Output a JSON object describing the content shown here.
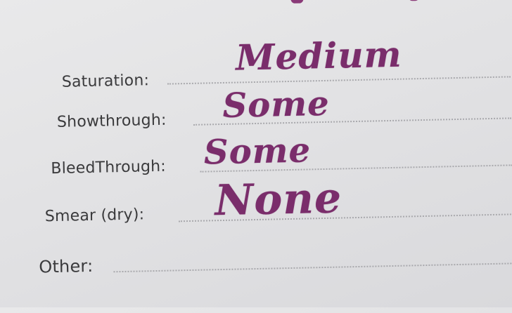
{
  "form": {
    "rows": [
      {
        "label": "Saturation:",
        "value": "Medium"
      },
      {
        "label": "Showthrough:",
        "value": "Some"
      },
      {
        "label": "BleedThrough:",
        "value": "Some"
      },
      {
        "label": "Smear (dry):",
        "value": "None"
      },
      {
        "label": "Other:",
        "value": ""
      }
    ]
  },
  "colors": {
    "paper": "#e4e4e6",
    "label_ink": "#3a3a3c",
    "handwriting_ink": "#7a2d6b"
  }
}
